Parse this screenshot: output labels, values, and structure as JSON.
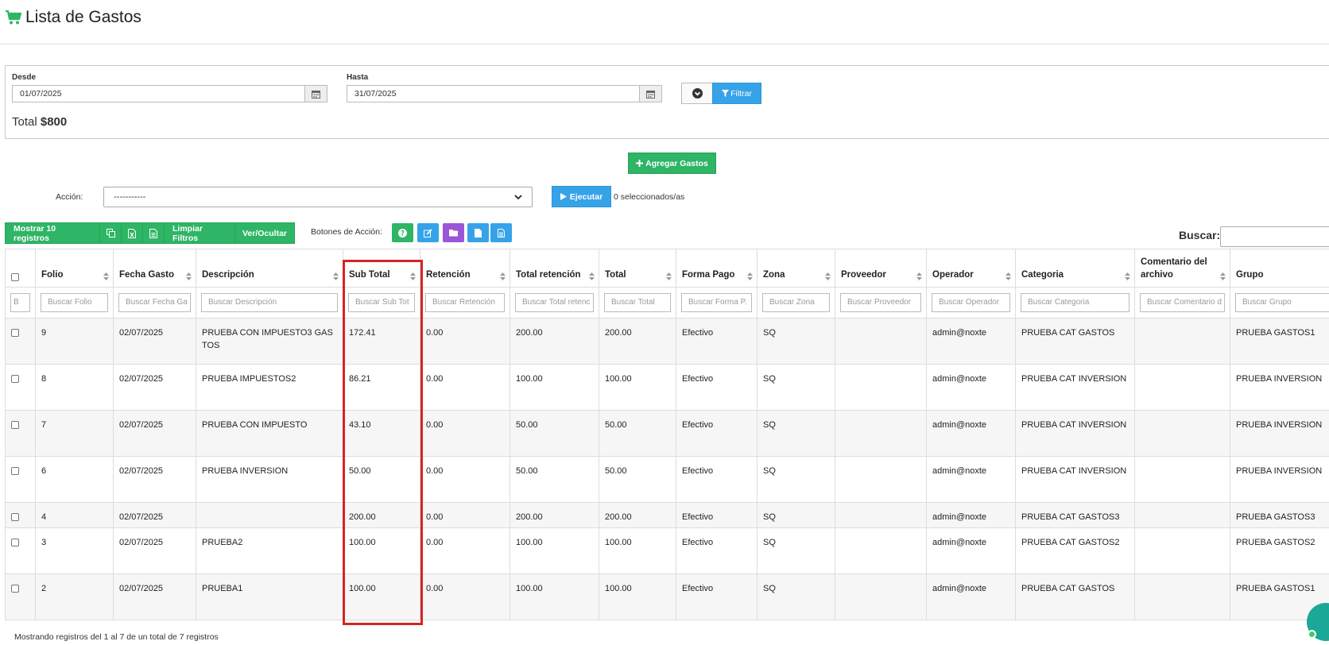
{
  "header": {
    "title": "Lista de Gastos",
    "icon": "cart-icon"
  },
  "filter": {
    "desde_label": "Desde",
    "desde_value": "01/07/2025",
    "hasta_label": "Hasta",
    "hasta_value": "31/07/2025",
    "filtrar_label": "Filtrar",
    "total_label": "Total",
    "total_value": "$800"
  },
  "agregar_label": "Agregar Gastos",
  "accion": {
    "label": "Acción:",
    "selected": "-----------",
    "ejecutar_label": "Ejecutar",
    "seleccionados": "0 seleccionados/as"
  },
  "toolbar": {
    "mostrar_label": "Mostrar 10 registros",
    "limpiar_label": "Limpiar Filtros",
    "ver_ocultar_label": "Ver/Ocultar",
    "botones_label": "Botones de Acción:"
  },
  "buscar_label": "Buscar:",
  "table": {
    "columns": [
      {
        "label": "",
        "search": "B"
      },
      {
        "label": "Folio",
        "search": "Buscar Folio"
      },
      {
        "label": "Fecha Gasto",
        "search": "Buscar Fecha Ga"
      },
      {
        "label": "Descripción",
        "search": "Buscar Descripción"
      },
      {
        "label": "Sub Total",
        "search": "Buscar Sub Tot"
      },
      {
        "label": "Retención",
        "search": "Buscar Retención"
      },
      {
        "label": "Total retención",
        "search": "Buscar Total retenc"
      },
      {
        "label": "Total",
        "search": "Buscar Total"
      },
      {
        "label": "Forma Pago",
        "search": "Buscar Forma P."
      },
      {
        "label": "Zona",
        "search": "Buscar Zona"
      },
      {
        "label": "Proveedor",
        "search": "Buscar Proveedor"
      },
      {
        "label": "Operador",
        "search": "Buscar Operador"
      },
      {
        "label": "Categoria",
        "search": "Buscar Categoria"
      },
      {
        "label": "Comentario del archivo",
        "search": "Buscar Comentario d"
      },
      {
        "label": "Grupo",
        "search": "Buscar Grupo"
      }
    ],
    "rows": [
      {
        "folio": "9",
        "fecha": "02/07/2025",
        "descripcion": "PRUEBA CON IMPUESTO3 GAS TOS",
        "subtotal": "172.41",
        "retencion": "0.00",
        "total_retencion": "200.00",
        "total": "200.00",
        "forma_pago": "Efectivo",
        "zona": "SQ",
        "proveedor": "",
        "operador": "admin@noxte",
        "categoria": "PRUEBA CAT GASTOS",
        "comentario": "",
        "grupo": "PRUEBA GASTOS1"
      },
      {
        "folio": "8",
        "fecha": "02/07/2025",
        "descripcion": "PRUEBA IMPUESTOS2",
        "subtotal": "86.21",
        "retencion": "0.00",
        "total_retencion": "100.00",
        "total": "100.00",
        "forma_pago": "Efectivo",
        "zona": "SQ",
        "proveedor": "",
        "operador": "admin@noxte",
        "categoria": "PRUEBA CAT INVERSION",
        "comentario": "",
        "grupo": "PRUEBA INVERSION"
      },
      {
        "folio": "7",
        "fecha": "02/07/2025",
        "descripcion": "PRUEBA CON IMPUESTO",
        "subtotal": "43.10",
        "retencion": "0.00",
        "total_retencion": "50.00",
        "total": "50.00",
        "forma_pago": "Efectivo",
        "zona": "SQ",
        "proveedor": "",
        "operador": "admin@noxte",
        "categoria": "PRUEBA CAT INVERSION",
        "comentario": "",
        "grupo": "PRUEBA INVERSION"
      },
      {
        "folio": "6",
        "fecha": "02/07/2025",
        "descripcion": "PRUEBA INVERSION",
        "subtotal": "50.00",
        "retencion": "0.00",
        "total_retencion": "50.00",
        "total": "50.00",
        "forma_pago": "Efectivo",
        "zona": "SQ",
        "proveedor": "",
        "operador": "admin@noxte",
        "categoria": "PRUEBA CAT INVERSION",
        "comentario": "",
        "grupo": "PRUEBA INVERSION"
      },
      {
        "folio": "4",
        "fecha": "02/07/2025",
        "descripcion": "",
        "subtotal": "200.00",
        "retencion": "0.00",
        "total_retencion": "200.00",
        "total": "200.00",
        "forma_pago": "Efectivo",
        "zona": "SQ",
        "proveedor": "",
        "operador": "admin@noxte",
        "categoria": "PRUEBA CAT GASTOS3",
        "comentario": "",
        "grupo": "PRUEBA GASTOS3"
      },
      {
        "folio": "3",
        "fecha": "02/07/2025",
        "descripcion": "PRUEBA2",
        "subtotal": "100.00",
        "retencion": "0.00",
        "total_retencion": "100.00",
        "total": "100.00",
        "forma_pago": "Efectivo",
        "zona": "SQ",
        "proveedor": "",
        "operador": "admin@noxte",
        "categoria": "PRUEBA CAT GASTOS2",
        "comentario": "",
        "grupo": "PRUEBA GASTOS2"
      },
      {
        "folio": "2",
        "fecha": "02/07/2025",
        "descripcion": "PRUEBA1",
        "subtotal": "100.00",
        "retencion": "0.00",
        "total_retencion": "100.00",
        "total": "100.00",
        "forma_pago": "Efectivo",
        "zona": "SQ",
        "proveedor": "",
        "operador": "admin@noxte",
        "categoria": "PRUEBA CAT GASTOS",
        "comentario": "",
        "grupo": "PRUEBA GASTOS1"
      }
    ]
  },
  "footer": {
    "info": "Mostrando registros del 1 al 7 de un total de 7 registros"
  },
  "colors": {
    "green": "#2eb565",
    "blue": "#36a3e8",
    "purple": "#9b56d8",
    "highlight": "#d42525"
  },
  "icons": [
    "cart-icon",
    "calendar-icon",
    "chevron-down-icon",
    "filter-icon",
    "plus-icon",
    "play-icon",
    "copy-icon",
    "excel-icon",
    "csv-icon",
    "help-icon",
    "edit-icon",
    "folder-icon",
    "file-icon",
    "document-icon",
    "sort-icon",
    "chat-icon"
  ]
}
